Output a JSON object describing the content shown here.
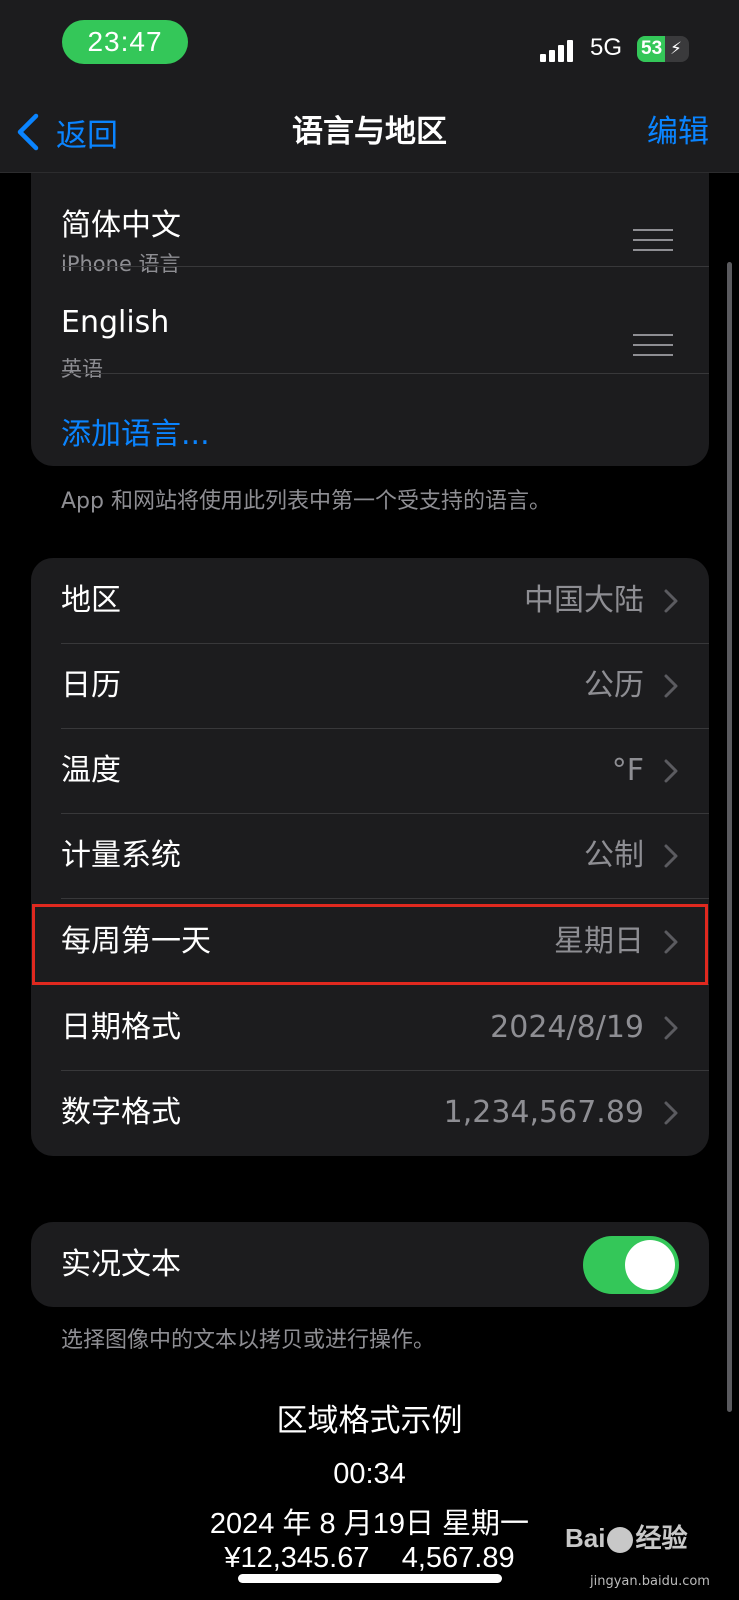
{
  "status_bar": {
    "time": "23:47",
    "network": "5G",
    "battery": "53",
    "battery_level": 0.53
  },
  "nav": {
    "back_label": "返回",
    "title": "语言与地区",
    "edit_label": "编辑"
  },
  "languages": {
    "items": [
      {
        "name": "简体中文",
        "subtitle": "iPhone 语言"
      },
      {
        "name": "English",
        "subtitle": "英语"
      }
    ],
    "add_label": "添加语言...",
    "footnote": "App 和网站将使用此列表中第一个受支持的语言。"
  },
  "region_settings": [
    {
      "label": "地区",
      "value": "中国大陆"
    },
    {
      "label": "日历",
      "value": "公历"
    },
    {
      "label": "温度",
      "value": "°F"
    },
    {
      "label": "计量系统",
      "value": "公制"
    },
    {
      "label": "每周第一天",
      "value": "星期日"
    },
    {
      "label": "日期格式",
      "value": "2024/8/19"
    },
    {
      "label": "数字格式",
      "value": "1,234,567.89"
    }
  ],
  "live_text": {
    "label": "实况文本",
    "enabled": true,
    "footnote": "选择图像中的文本以拷贝或进行操作。"
  },
  "example": {
    "title": "区域格式示例",
    "time": "00:34",
    "date": "2024 年 8 月19日 星期一",
    "numbers": "¥12,345.67    4,567.89"
  },
  "watermark": {
    "text_left": "Bai",
    "text_right": "经验",
    "url": "jingyan.baidu.com"
  },
  "colors": {
    "accent": "#0a84ff",
    "toggle_on": "#34c759",
    "highlight": "#e0291f",
    "group_bg": "#1c1c1e"
  }
}
